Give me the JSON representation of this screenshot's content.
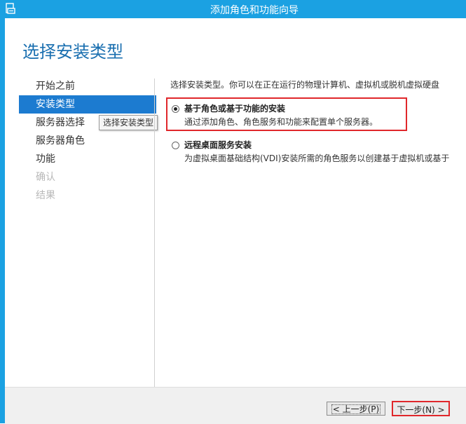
{
  "window": {
    "title": "添加角色和功能向导",
    "accent_color": "#1ba1e2",
    "icon": "server-manager-icon"
  },
  "page": {
    "heading": "选择安装类型"
  },
  "nav": {
    "items": [
      {
        "label": "开始之前",
        "state": "normal"
      },
      {
        "label": "安装类型",
        "state": "active"
      },
      {
        "label": "服务器选择",
        "state": "normal"
      },
      {
        "label": "服务器角色",
        "state": "normal"
      },
      {
        "label": "功能",
        "state": "normal"
      },
      {
        "label": "确认",
        "state": "disabled"
      },
      {
        "label": "结果",
        "state": "disabled"
      }
    ],
    "tooltip": "选择安装类型"
  },
  "content": {
    "intro": "选择安装类型。你可以在正在运行的物理计算机、虚拟机或脱机虚拟硬盘",
    "options": [
      {
        "title": "基于角色或基于功能的安装",
        "description": "通过添加角色、角色服务和功能来配置单个服务器。",
        "selected": true
      },
      {
        "title": "远程桌面服务安装",
        "description": "为虚拟桌面基础结构(VDI)安装所需的角色服务以创建基于虚拟机或基于",
        "selected": false
      }
    ]
  },
  "footer": {
    "back_label": "< 上一步(P)",
    "next_label": "下一步(N) >"
  },
  "colors": {
    "highlight": "#e0272b",
    "nav_active": "#1c7bd0",
    "heading": "#1a6fb0"
  }
}
